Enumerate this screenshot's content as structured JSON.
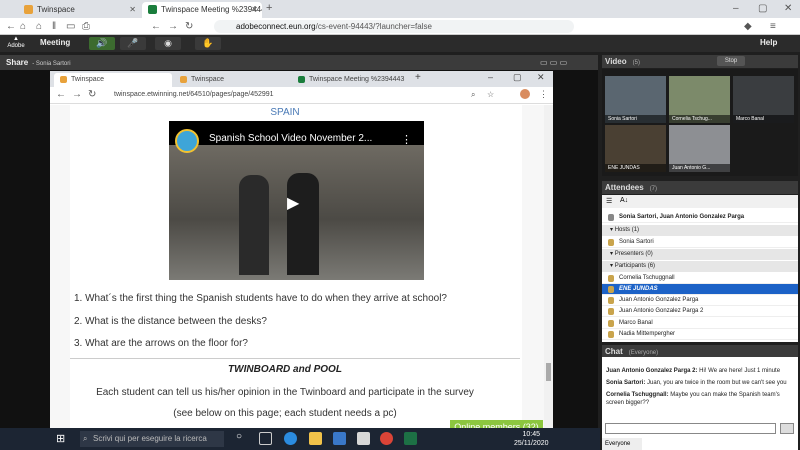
{
  "outer_browser": {
    "tabs": [
      {
        "label": "Twinspace"
      },
      {
        "label": "Twinspace Meeting %2394443"
      }
    ],
    "url_host": "adobeconnect.eun.org",
    "url_path": "/cs-event-94443/?launcher=false"
  },
  "connect": {
    "menu": "Meeting",
    "help": "Help"
  },
  "share_pod": {
    "title": "Share",
    "presenter": "- Sonia Sartori"
  },
  "inner_browser": {
    "tabs": [
      {
        "label": "Twinspace"
      },
      {
        "label": "Twinspace"
      },
      {
        "label": "Twinspace Meeting %2394443"
      }
    ],
    "url": "twinspace.etwinning.net/64510/pages/page/452991"
  },
  "page": {
    "heading": "SPAIN",
    "video_title": "Spanish School Video November 2...",
    "questions": [
      "1. What´s the first thing the Spanish students have to do when they arrive at school?",
      "2. What is the distance between the desks?",
      "3. What are the arrows on the floor for?"
    ],
    "pool_title": "TWINBOARD and POOL",
    "pool_text_1": "Each student can tell us his/her opinion in the Twinboard and participate in the survey",
    "pool_text_2": "(see below on this page; each student needs a pc)",
    "online_members": "Online members (32)"
  },
  "taskbar": {
    "search_placeholder": "Scrivi qui per eseguire la ricerca",
    "time": "10:45",
    "date": "25/11/2020"
  },
  "video_pod": {
    "title": "Video",
    "count": "(5)",
    "stop_label": "Stop",
    "cams": [
      {
        "name": "Sonia Sartori"
      },
      {
        "name": "Cornelia Tschug..."
      },
      {
        "name": "Marco Banal"
      },
      {
        "name": "ENE JUNDAS"
      },
      {
        "name": "Juan Antonio G..."
      }
    ]
  },
  "attendees_pod": {
    "title": "Attendees",
    "count": "(7)",
    "presenters_line": "Sonia Sartori, Juan Antonio Gonzalez Parga",
    "hosts_label": "Hosts (1)",
    "hosts": [
      "Sonia Sartori"
    ],
    "presenters_label": "Presenters (0)",
    "participants_label": "Participants (6)",
    "participants": [
      "Cornelia Tschuggnall",
      "ENE JUNDAS",
      "Juan Antonio Gonzalez Parga",
      "Juan Antonio Gonzalez Parga 2",
      "Marco Banal",
      "Nadia Mittempergher"
    ]
  },
  "chat_pod": {
    "title": "Chat",
    "scope": "(Everyone)",
    "messages": [
      {
        "from": "Juan Antonio Gonzalez Parga 2:",
        "text": " Hi! We are here! Just 1 minute"
      },
      {
        "from": "Sonia Sartori:",
        "text": " Juan, you are twice in the room but we can't see you"
      },
      {
        "from": "Cornelia Tschuggnall:",
        "text": " Maybe you can make the Spanish team's screen bigger??"
      }
    ],
    "tab": "Everyone"
  }
}
